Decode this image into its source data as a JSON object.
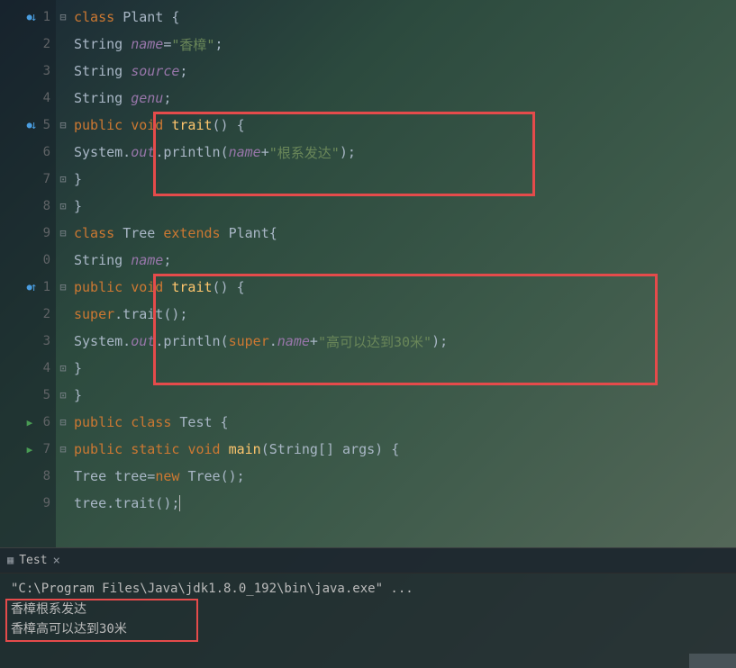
{
  "gutter": {
    "lines": [
      {
        "num": "1",
        "icons": [
          "override-down"
        ]
      },
      {
        "num": "2"
      },
      {
        "num": "3"
      },
      {
        "num": "4"
      },
      {
        "num": "5",
        "icons": [
          "override-down"
        ]
      },
      {
        "num": "6"
      },
      {
        "num": "7"
      },
      {
        "num": "8"
      },
      {
        "num": "9"
      },
      {
        "num": "0"
      },
      {
        "num": "1",
        "icons": [
          "override-up"
        ]
      },
      {
        "num": "2"
      },
      {
        "num": "3"
      },
      {
        "num": "4"
      },
      {
        "num": "5"
      },
      {
        "num": "6",
        "icons": [
          "play"
        ]
      },
      {
        "num": "7",
        "icons": [
          "play"
        ]
      },
      {
        "num": "8"
      },
      {
        "num": "9"
      }
    ]
  },
  "code": {
    "l1": {
      "class": "class ",
      "name": "Plant",
      "brace": " {"
    },
    "l2": {
      "type": "String ",
      "name": "name",
      "eq": "=",
      "str": "\"香樟\"",
      "semi": ";"
    },
    "l3": {
      "type": "String ",
      "name": "source",
      "semi": ";"
    },
    "l4": {
      "type": "String ",
      "name": "genu",
      "semi": ";"
    },
    "l5": {
      "pub": "public ",
      "void": "void ",
      "method": "trait",
      "parens": "() {"
    },
    "l6": {
      "sys": "System.",
      "out": "out",
      "dot": ".",
      "print": "println",
      "open": "(",
      "name": "name",
      "plus": "+",
      "str": "\"根系发达\"",
      "close": ");"
    },
    "l7": {
      "brace": "}"
    },
    "l8": {
      "brace": "}"
    },
    "l9": {
      "class": "class ",
      "name": "Tree ",
      "ext": "extends ",
      "parent": "Plant",
      "brace": "{"
    },
    "l10": {
      "type": "String ",
      "name": "name",
      "semi": ";"
    },
    "l11": {
      "pub": "public ",
      "void": "void ",
      "method": "trait",
      "parens": "() {"
    },
    "l12": {
      "super": "super",
      "call": ".trait();"
    },
    "l13": {
      "sys": "System.",
      "out": "out",
      "dot": ".",
      "print": "println",
      "open": "(",
      "super": "super",
      "dotname": ".",
      "name": "name",
      "plus": "+",
      "str": "\"高可以达到30米\"",
      "close": ");"
    },
    "l14": {
      "brace": "}"
    },
    "l15": {
      "brace": "}"
    },
    "l16": {
      "pub": "public ",
      "class": "class ",
      "name": "Test",
      "brace": " {"
    },
    "l17": {
      "pub": "public ",
      "static": "static ",
      "void": "void ",
      "main": "main",
      "args": "(String[] args) {"
    },
    "l18": {
      "type": "Tree ",
      "var": "tree",
      "eq": "=",
      "new": "new ",
      "ctor": "Tree",
      "call": "();"
    },
    "l19": {
      "var": "tree",
      "call": ".trait();"
    }
  },
  "console": {
    "tab": "Test",
    "line1": "\"C:\\Program Files\\Java\\jdk1.8.0_192\\bin\\java.exe\" ...",
    "line2": "香樟根系发达",
    "line3": "香樟高可以达到30米"
  }
}
